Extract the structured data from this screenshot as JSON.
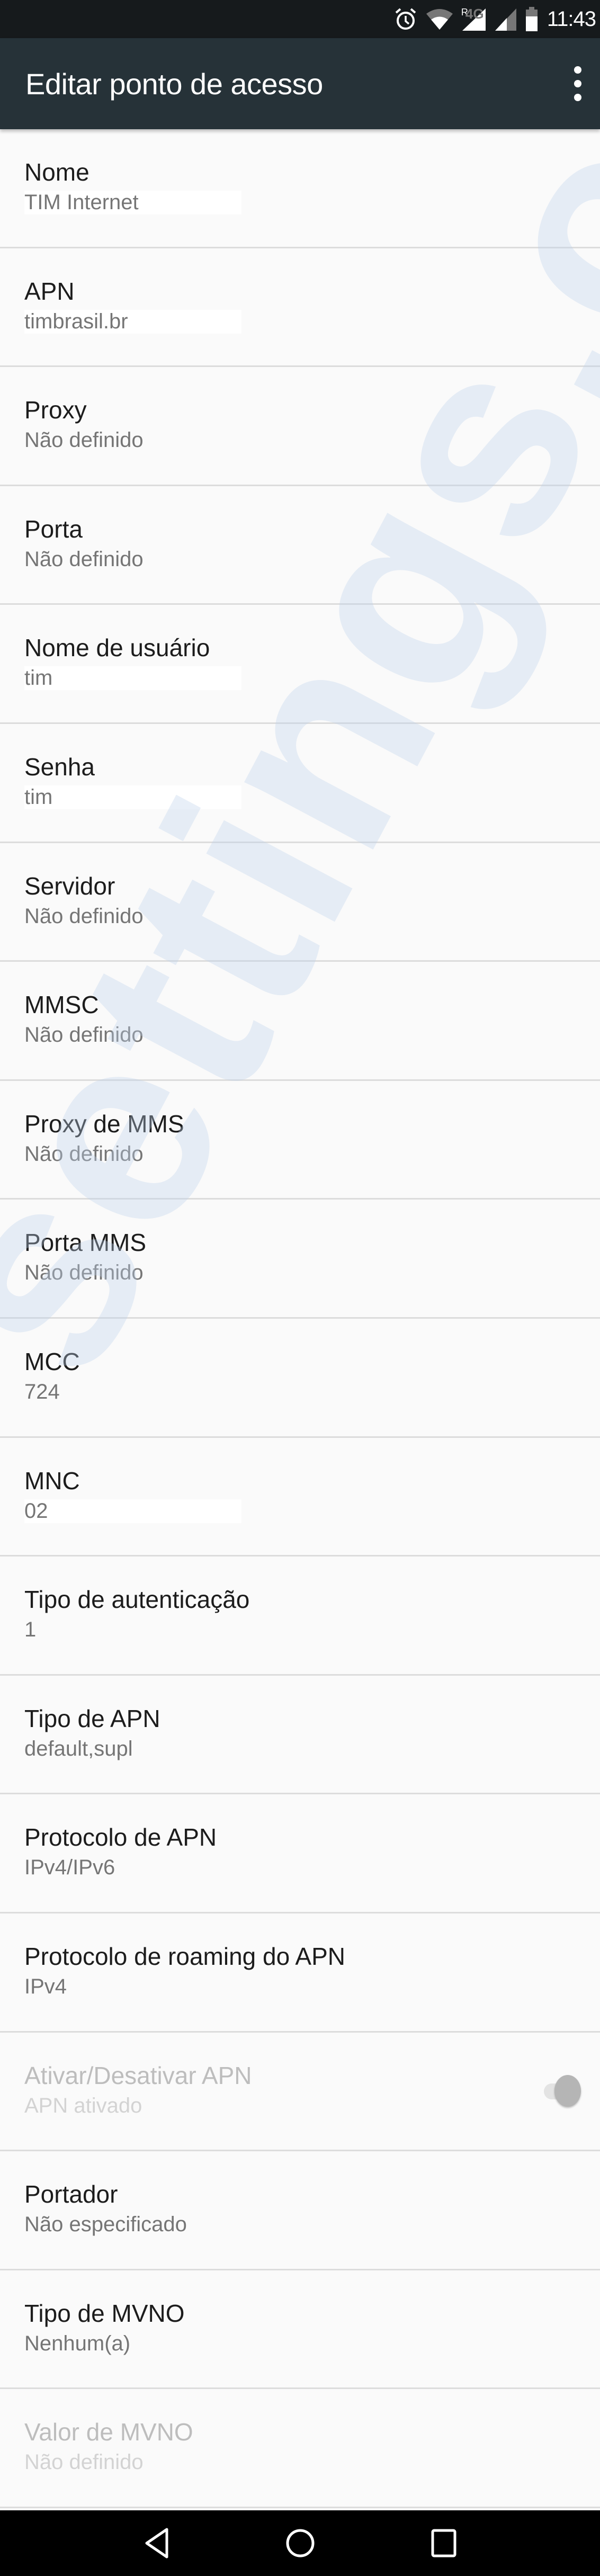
{
  "status_bar": {
    "time": "11:43",
    "icons": [
      "alarm-icon",
      "wifi-icon",
      "roaming-signal-icon",
      "4g-signal-icon",
      "battery-icon"
    ],
    "roaming_label": "R",
    "network_label": "4G"
  },
  "app_bar": {
    "title": "Editar ponto de acesso",
    "menu_icon": "more-vert-icon"
  },
  "watermark": "settings.o",
  "fields": [
    {
      "label": "Nome",
      "value": "TIM Internet",
      "masked": true
    },
    {
      "label": "APN",
      "value": "timbrasil.br",
      "masked": true
    },
    {
      "label": "Proxy",
      "value": "Não definido"
    },
    {
      "label": "Porta",
      "value": "Não definido"
    },
    {
      "label": "Nome de usuário",
      "value": "tim",
      "masked": true
    },
    {
      "label": "Senha",
      "value": "tim",
      "masked": true
    },
    {
      "label": "Servidor",
      "value": "Não definido"
    },
    {
      "label": "MMSC",
      "value": "Não definido"
    },
    {
      "label": "Proxy de MMS",
      "value": "Não definido"
    },
    {
      "label": "Porta MMS",
      "value": "Não definido"
    },
    {
      "label": "MCC",
      "value": "724"
    },
    {
      "label": "MNC",
      "value": "02",
      "masked": true
    },
    {
      "label": "Tipo de autenticação",
      "value": "1"
    },
    {
      "label": "Tipo de APN",
      "value": "default,supl"
    },
    {
      "label": "Protocolo de APN",
      "value": "IPv4/IPv6"
    },
    {
      "label": "Protocolo de roaming do APN",
      "value": "IPv4"
    },
    {
      "label": "Ativar/Desativar APN",
      "value": "APN ativado",
      "disabled": true,
      "toggle": true,
      "toggle_on": true
    },
    {
      "label": "Portador",
      "value": "Não especificado"
    },
    {
      "label": "Tipo de MVNO",
      "value": "Nenhum(a)"
    },
    {
      "label": "Valor de MVNO",
      "value": "Não definido",
      "disabled": true
    }
  ],
  "nav_bar": {
    "buttons": [
      "back-icon",
      "home-icon",
      "recents-icon"
    ]
  },
  "colors": {
    "status_bar": "#161a1c",
    "app_bar": "#263238",
    "background": "#fafafa",
    "divider": "#dcdcdc",
    "label": "#1c1c1c",
    "value": "#757575",
    "disabled_label": "#bdbdbd",
    "disabled_value": "#d3d3d3",
    "nav_bar": "#000000"
  }
}
